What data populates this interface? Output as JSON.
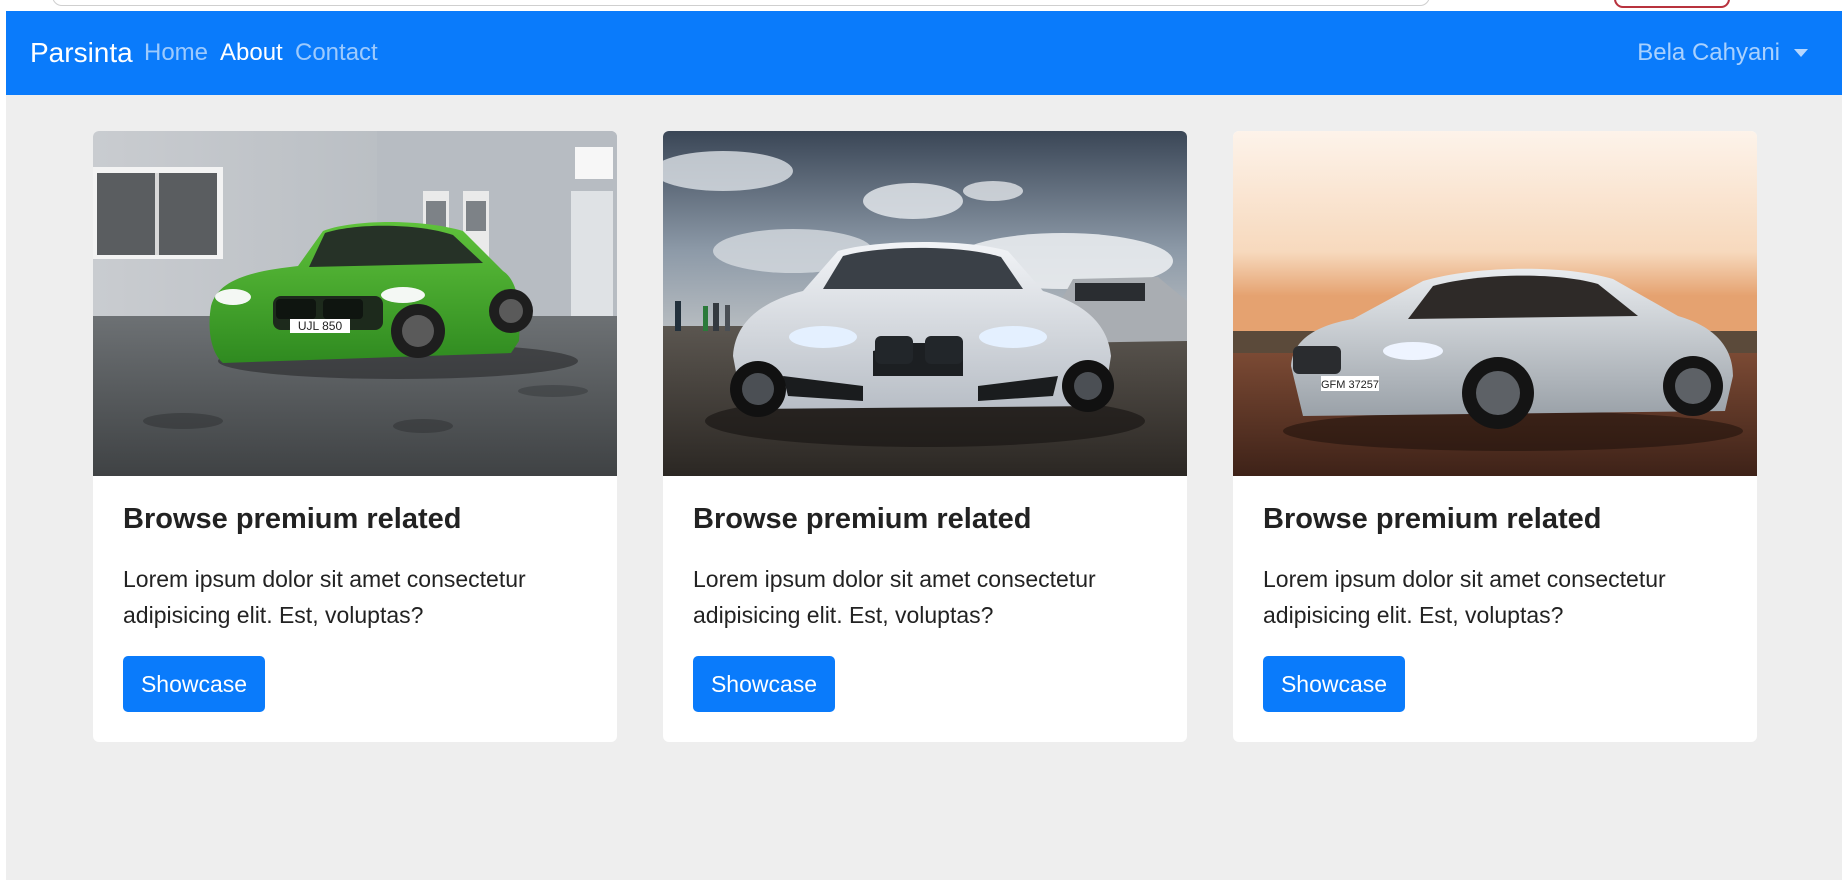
{
  "navbar": {
    "brand": "Parsinta",
    "links": [
      {
        "label": "Home",
        "active": false
      },
      {
        "label": "About",
        "active": true
      },
      {
        "label": "Contact",
        "active": false
      }
    ],
    "user": "Bela Cahyani"
  },
  "cards": [
    {
      "title": "Browse premium related",
      "text": "Lorem ipsum dolor sit amet consectetur adipisicing elit. Est, voluptas?",
      "button": "Showcase",
      "image": "green-bmw-car-photo",
      "plate": "UJL 850"
    },
    {
      "title": "Browse premium related",
      "text": "Lorem ipsum dolor sit amet consectetur adipisicing elit. Est, voluptas?",
      "button": "Showcase",
      "image": "white-bmw-car-photo"
    },
    {
      "title": "Browse premium related",
      "text": "Lorem ipsum dolor sit amet consectetur adipisicing elit. Est, voluptas?",
      "button": "Showcase",
      "image": "silver-bmw-coupe-photo",
      "plate": "GFM 37257"
    }
  ],
  "colors": {
    "primary": "#0a7bfb",
    "background": "#eeeeee",
    "card": "#ffffff"
  }
}
